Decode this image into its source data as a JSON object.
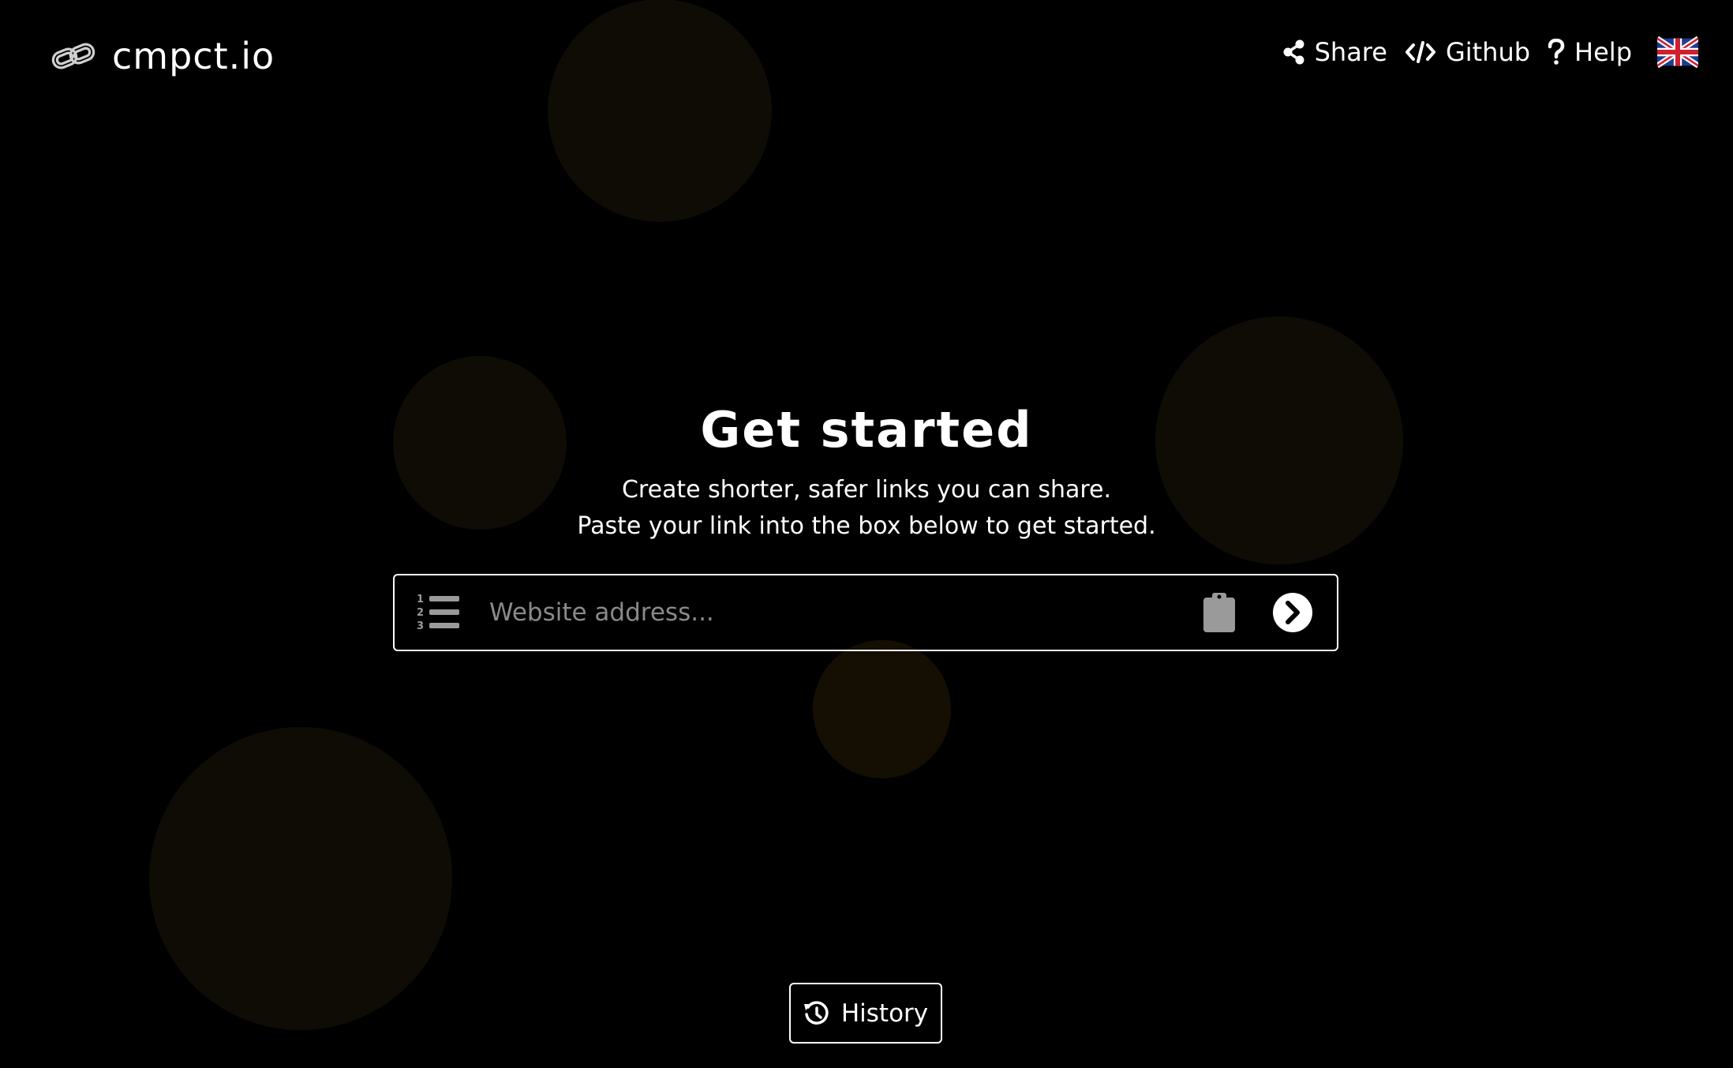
{
  "brand": {
    "name": "cmpct.io",
    "logo_icon": "chain-link-icon"
  },
  "nav": {
    "items": [
      {
        "label": "Share",
        "icon": "share-icon"
      },
      {
        "label": "Github",
        "icon": "code-icon"
      },
      {
        "label": "Help",
        "icon": "question-icon"
      }
    ],
    "language_icon": "uk-flag-icon"
  },
  "hero": {
    "title": "Get started",
    "line1": "Create shorter, safer links you can share.",
    "line2": "Paste your link into the box below to get started."
  },
  "url_box": {
    "placeholder": "Website address...",
    "value": "",
    "list_icon": "numbered-list-icon",
    "paste_icon": "clipboard-icon",
    "submit_icon": "arrow-right-circle-icon"
  },
  "history": {
    "label": "History",
    "icon": "history-icon"
  },
  "colors": {
    "background": "#000000",
    "text": "#ffffff",
    "placeholder": "#8a8a8a",
    "bubble": "#0e0c04",
    "bubble_warm": "#150e03"
  }
}
